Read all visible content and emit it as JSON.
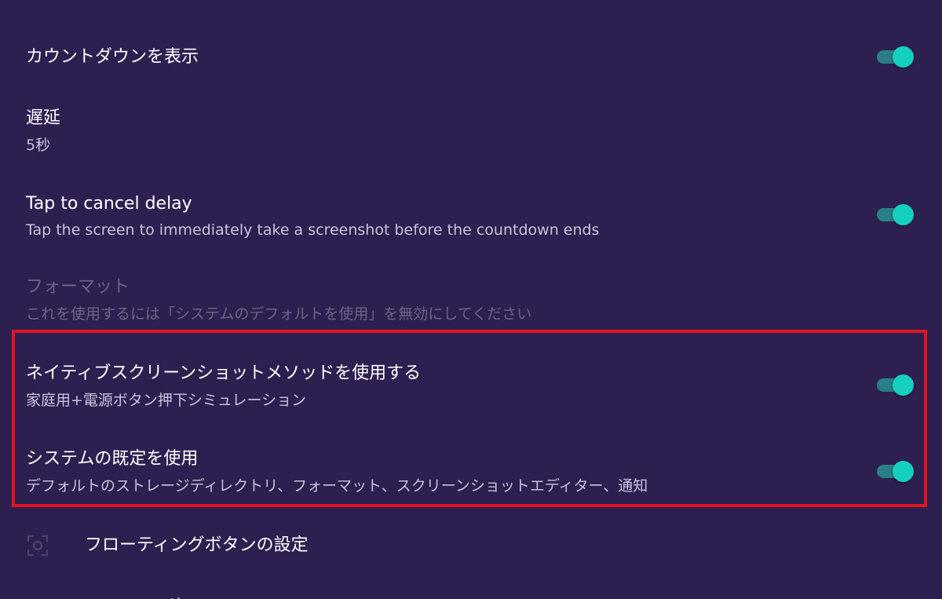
{
  "settings": {
    "countdown": {
      "title": "カウントダウンを表示",
      "enabled": true
    },
    "delay": {
      "title": "遅延",
      "summary": "5秒"
    },
    "tap_cancel": {
      "title": "Tap to cancel delay",
      "summary": "Tap the screen to immediately take a screenshot before the countdown ends",
      "enabled": true
    },
    "format": {
      "title": "フォーマット",
      "summary": "これを使用するには「システムのデフォルトを使用」を無効にしてください",
      "disabled": true
    },
    "native_method": {
      "title": "ネイティブスクリーンショットメソッドを使用する",
      "summary": "家庭用+電源ボタン押下シミュレーション",
      "enabled": true
    },
    "system_default": {
      "title": "システムの既定を使用",
      "summary": "デフォルトのストレージディレクトリ、フォーマット、スクリーンショットエディター、通知",
      "enabled": true
    },
    "floating_button": {
      "label": "フローティングボタンの設定",
      "icon": "floating-button-icon"
    }
  },
  "colors": {
    "background": "#2d2050",
    "switch_thumb": "#16d0be",
    "switch_track": "#2a7f86",
    "highlight_border": "#e0141e",
    "summary_text": "#c9c2dc",
    "disabled_text": "#6d6386"
  }
}
